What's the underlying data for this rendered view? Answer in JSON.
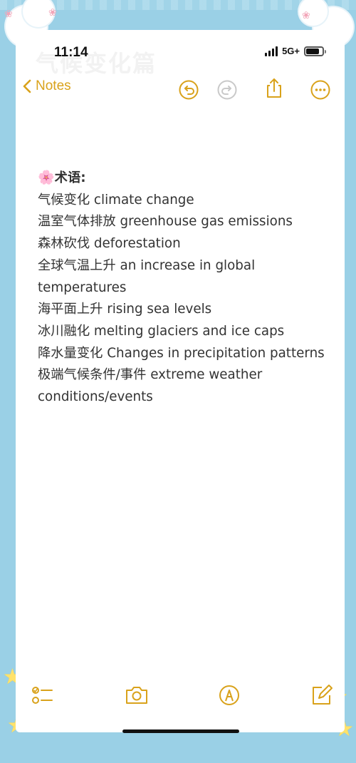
{
  "status_bar": {
    "time": "11:14",
    "network": "5G+",
    "battery_level": 0.8
  },
  "nav": {
    "back_label": "Notes",
    "accent_color": "#d9a21b",
    "icons": [
      "undo-icon",
      "redo-icon",
      "share-icon",
      "more-icon"
    ]
  },
  "background_title": "气候变化篇",
  "note": {
    "heading": "术语:",
    "heading_emoji": "🌸",
    "lines": [
      "气候变化 climate change",
      "温室气体排放 greenhouse gas emissions",
      "森林砍伐 deforestation",
      "全球气温上升 an increase in global temperatures",
      "海平面上升 rising sea levels",
      "冰川融化 melting glaciers and ice caps",
      "降水量变化 Changes in precipitation patterns",
      "极端气候条件/事件 extreme weather conditions/events"
    ]
  },
  "toolbar": {
    "icons": [
      "checklist-icon",
      "camera-icon",
      "markup-icon",
      "compose-icon"
    ]
  }
}
